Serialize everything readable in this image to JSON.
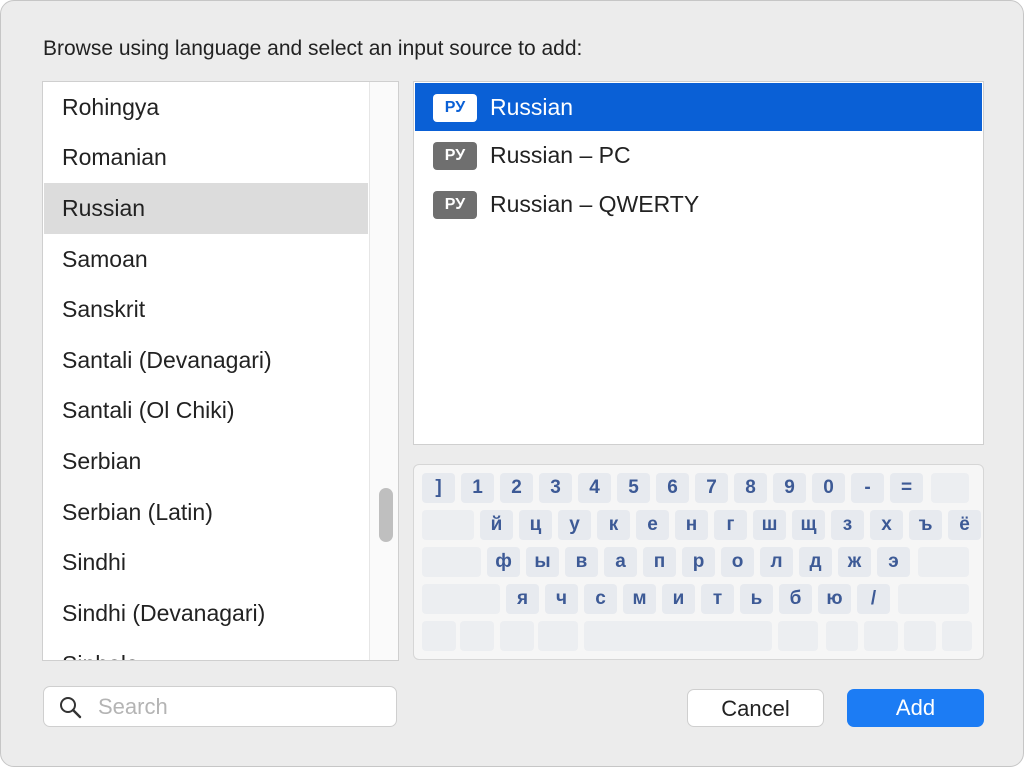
{
  "dialog": {
    "prompt": "Browse using language and select an input source to add:"
  },
  "languages": [
    {
      "label": "Rohingya",
      "selected": false
    },
    {
      "label": "Romanian",
      "selected": false
    },
    {
      "label": "Russian",
      "selected": true
    },
    {
      "label": "Samoan",
      "selected": false
    },
    {
      "label": "Sanskrit",
      "selected": false
    },
    {
      "label": "Santali (Devanagari)",
      "selected": false
    },
    {
      "label": "Santali (Ol Chiki)",
      "selected": false
    },
    {
      "label": "Serbian",
      "selected": false
    },
    {
      "label": "Serbian (Latin)",
      "selected": false
    },
    {
      "label": "Sindhi",
      "selected": false
    },
    {
      "label": "Sindhi (Devanagari)",
      "selected": false
    },
    {
      "label": "Sinhala",
      "selected": false
    }
  ],
  "input_sources": [
    {
      "badge": "РУ",
      "label": "Russian",
      "selected": true
    },
    {
      "badge": "РУ",
      "label": "Russian – PC",
      "selected": false
    },
    {
      "badge": "РУ",
      "label": "Russian – QWERTY",
      "selected": false
    }
  ],
  "keyboard": {
    "rows": [
      [
        "]",
        "1",
        "2",
        "3",
        "4",
        "5",
        "6",
        "7",
        "8",
        "9",
        "0",
        "-",
        "="
      ],
      [
        "й",
        "ц",
        "у",
        "к",
        "е",
        "н",
        "г",
        "ш",
        "щ",
        "з",
        "х",
        "ъ",
        "ё"
      ],
      [
        "ф",
        "ы",
        "в",
        "а",
        "п",
        "р",
        "о",
        "л",
        "д",
        "ж",
        "э"
      ],
      [
        "я",
        "ч",
        "с",
        "м",
        "и",
        "т",
        "ь",
        "б",
        "ю",
        "/"
      ]
    ]
  },
  "search": {
    "placeholder": "Search",
    "value": ""
  },
  "buttons": {
    "cancel": "Cancel",
    "add": "Add"
  },
  "colors": {
    "accent": "#1c7cf4",
    "selection": "#0a60d6",
    "key_text": "#3d5a96"
  }
}
